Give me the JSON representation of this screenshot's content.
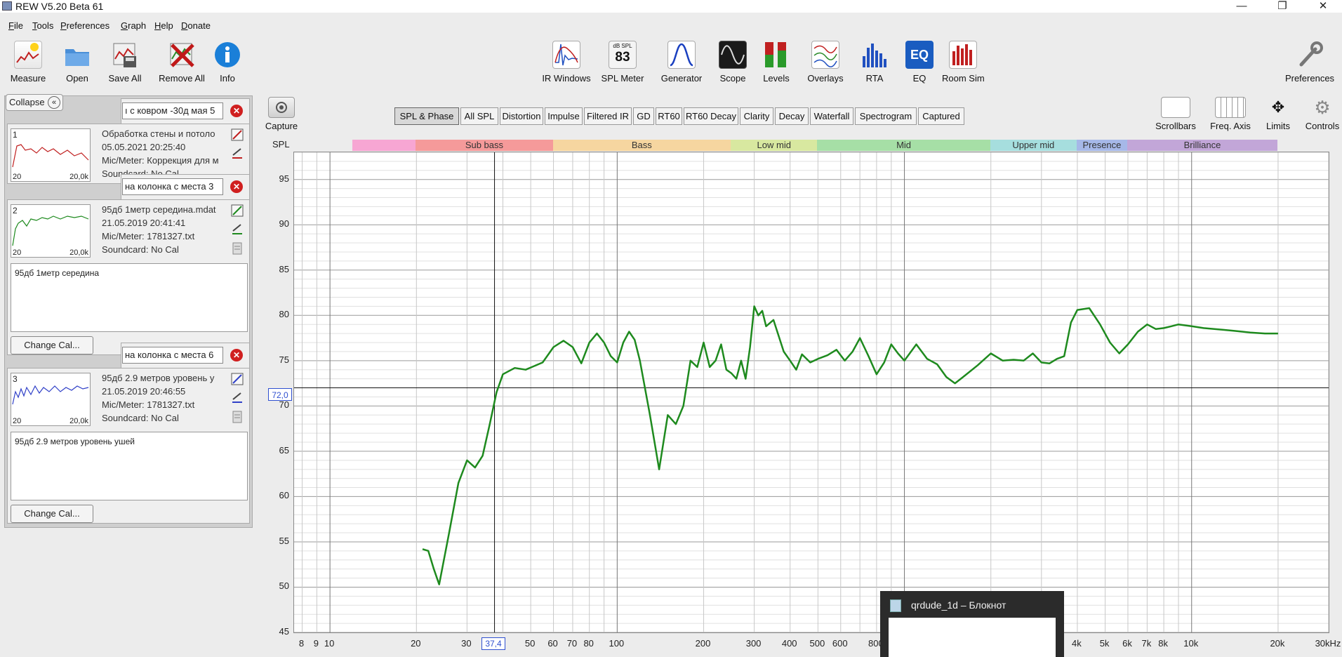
{
  "window": {
    "title": "REW V5.20 Beta 61",
    "minimize": "—",
    "restore": "❐",
    "close": "✕"
  },
  "menu": [
    "File",
    "Tools",
    "Preferences",
    "Graph",
    "Help",
    "Donate"
  ],
  "toolbar_left": [
    {
      "label": "Measure",
      "icon": "measure-icon"
    },
    {
      "label": "Open",
      "icon": "folder-icon"
    },
    {
      "label": "Save All",
      "icon": "save-all-icon"
    },
    {
      "label": "Remove All",
      "icon": "remove-all-icon"
    },
    {
      "label": "Info",
      "icon": "info-icon"
    }
  ],
  "toolbar_center": [
    {
      "label": "IR Windows",
      "icon": "ir-windows-icon"
    },
    {
      "label": "SPL Meter",
      "icon": "spl-meter-icon",
      "top": "dB SPL",
      "value": "83"
    },
    {
      "label": "Generator",
      "icon": "generator-icon"
    },
    {
      "label": "Scope",
      "icon": "scope-icon"
    },
    {
      "label": "Levels",
      "icon": "levels-icon"
    },
    {
      "label": "Overlays",
      "icon": "overlays-icon"
    },
    {
      "label": "RTA",
      "icon": "rta-icon"
    },
    {
      "label": "EQ",
      "icon": "eq-icon",
      "text": "EQ"
    },
    {
      "label": "Room Sim",
      "icon": "room-sim-icon"
    }
  ],
  "toolbar_right": {
    "label": "Preferences",
    "icon": "wrench-icon"
  },
  "capture": {
    "label": "Capture"
  },
  "graph_controls": [
    {
      "label": "Scrollbars"
    },
    {
      "label": "Freq. Axis"
    },
    {
      "label": "Limits"
    },
    {
      "label": "Controls"
    }
  ],
  "collapse": {
    "label": "Collapse",
    "icon": "«"
  },
  "measurements": [
    {
      "num": "1",
      "name": "ı с ковром -30д мая 5",
      "title": "Обработка стены и потоло",
      "date": "05.05.2021 20:25:40",
      "mic": "Mic/Meter: Коррекция для м",
      "sound": "Soundcard: No Cal",
      "thumb_lo": "20",
      "thumb_hi": "20,0k"
    },
    {
      "num": "2",
      "name": "на колонка с места 3",
      "title": "95дб 1метр середина.mdat",
      "date": "21.05.2019 20:41:41",
      "mic": "Mic/Meter: 1781327.txt",
      "sound": "Soundcard: No Cal",
      "notes": "95дб 1метр середина",
      "change_cal": "Change Cal...",
      "thumb_lo": "20",
      "thumb_hi": "20,0k"
    },
    {
      "num": "3",
      "name": "на колонка с места 6",
      "title": "95дб 2.9 метров уровень у",
      "date": "21.05.2019 20:46:55",
      "mic": "Mic/Meter: 1781327.txt",
      "sound": "Soundcard: No Cal",
      "notes": "95дб 2.9 метров уровень ушей",
      "change_cal": "Change Cal...",
      "thumb_lo": "20",
      "thumb_hi": "20,0k"
    }
  ],
  "graph_tabs": [
    "SPL & Phase",
    "All SPL",
    "Distortion",
    "Impulse",
    "Filtered IR",
    "GD",
    "RT60",
    "RT60 Decay",
    "Clarity",
    "Decay",
    "Waterfall",
    "Spectrogram",
    "Captured"
  ],
  "selected_tab": "SPL & Phase",
  "bands": [
    {
      "label": "",
      "color": "#f7a6d3"
    },
    {
      "label": "Sub bass",
      "color": "#f59a9a"
    },
    {
      "label": "Bass",
      "color": "#f6d6a0"
    },
    {
      "label": "Low mid",
      "color": "#d8e8a0"
    },
    {
      "label": "Mid",
      "color": "#a6dfa6"
    },
    {
      "label": "Upper mid",
      "color": "#a6dede"
    },
    {
      "label": "Presence",
      "color": "#a6b8e8"
    },
    {
      "label": "Brilliance",
      "color": "#c2a6d8"
    }
  ],
  "axis": {
    "y_label": "SPL",
    "cursor_y": "72,0",
    "cursor_x": "37,4"
  },
  "chart_data": {
    "type": "line",
    "title": "",
    "xlabel": "",
    "ylabel": "SPL",
    "x_scale": "log",
    "xlim": [
      7.5,
      30000
    ],
    "ylim": [
      45,
      98
    ],
    "y_ticks": [
      45,
      50,
      55,
      60,
      65,
      70,
      75,
      80,
      85,
      90,
      95
    ],
    "x_tick_labels": [
      "8",
      "9",
      "10",
      "20",
      "30",
      "50",
      "60",
      "70",
      "80",
      "100",
      "200",
      "300",
      "400",
      "500",
      "600",
      "800",
      "4k",
      "5k",
      "6k",
      "7k",
      "8k",
      "10k",
      "20k",
      "30kHz"
    ],
    "x_tick_values": [
      8,
      9,
      10,
      20,
      30,
      50,
      60,
      70,
      80,
      100,
      200,
      300,
      400,
      500,
      600,
      800,
      4000,
      5000,
      6000,
      7000,
      8000,
      10000,
      20000,
      30000
    ],
    "cursor": {
      "x": 37.4,
      "y": 72.0
    },
    "grid": true,
    "series": [
      {
        "color": "#1e8a1e",
        "x": [
          21,
          22,
          23,
          24,
          26,
          28,
          30,
          32,
          34,
          36,
          38,
          40,
          44,
          48,
          55,
          60,
          65,
          70,
          75,
          80,
          85,
          90,
          95,
          100,
          105,
          110,
          115,
          120,
          130,
          140,
          150,
          160,
          170,
          180,
          190,
          200,
          210,
          220,
          230,
          240,
          250,
          260,
          270,
          280,
          290,
          300,
          310,
          320,
          330,
          350,
          380,
          400,
          420,
          440,
          470,
          500,
          540,
          580,
          620,
          660,
          700,
          750,
          800,
          850,
          900,
          950,
          1000,
          1100,
          1200,
          1300,
          1400,
          1500,
          1600,
          1800,
          2000,
          2200,
          2400,
          2600,
          2800,
          3000,
          3200,
          3400,
          3600,
          3800,
          4000,
          4400,
          4800,
          5200,
          5600,
          6000,
          6500,
          7000,
          7500,
          8000,
          8500,
          9000,
          10000,
          11000,
          12000,
          13000,
          14000,
          15000,
          16000,
          18000,
          20000
        ],
        "y": [
          54.2,
          54.0,
          52.0,
          50.3,
          56.0,
          61.5,
          64.0,
          63.2,
          64.5,
          68.0,
          71.5,
          73.5,
          74.2,
          74.0,
          74.8,
          76.5,
          77.2,
          76.5,
          74.7,
          77.0,
          78.0,
          77.0,
          75.5,
          74.8,
          77.0,
          78.2,
          77.3,
          75.0,
          69.0,
          63.0,
          69.0,
          68.0,
          70.0,
          75.0,
          74.3,
          77.0,
          74.3,
          75.0,
          76.8,
          74.0,
          73.6,
          73.0,
          75.0,
          73.0,
          76.5,
          81.0,
          80.0,
          80.5,
          78.8,
          79.5,
          76.0,
          75.0,
          74.0,
          75.7,
          74.8,
          75.2,
          75.6,
          76.2,
          75.0,
          76.0,
          77.5,
          75.5,
          73.5,
          74.8,
          76.8,
          75.8,
          75.0,
          76.8,
          75.2,
          74.6,
          73.2,
          72.5,
          73.2,
          74.5,
          75.8,
          75.0,
          75.1,
          75.0,
          75.8,
          74.8,
          74.7,
          75.2,
          75.5,
          79.2,
          80.6,
          80.8,
          79.0,
          77.0,
          75.8,
          76.8,
          78.2,
          79.0,
          78.5,
          78.6,
          78.8,
          79.0,
          78.8,
          78.6,
          78.5,
          78.4,
          78.3,
          78.2,
          78.1,
          78.0,
          78.0
        ]
      }
    ]
  },
  "notepad": {
    "title": "qrdude_1d – Блокнот"
  }
}
